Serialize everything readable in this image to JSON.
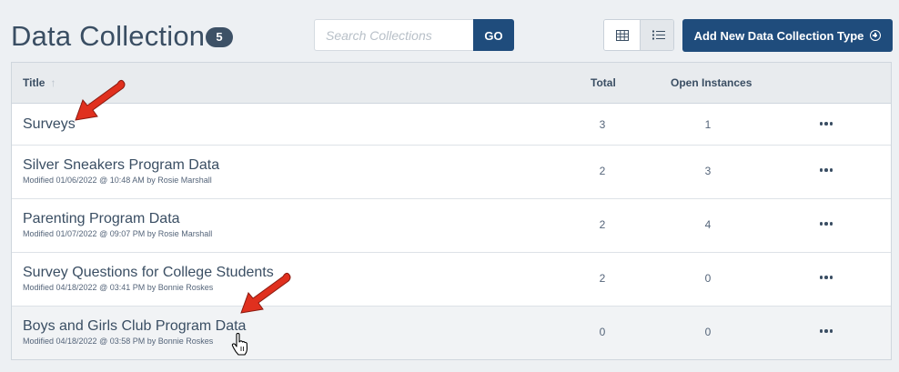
{
  "header": {
    "title": "Data Collection",
    "count": "5"
  },
  "search": {
    "placeholder": "Search Collections",
    "value": "",
    "go_label": "GO"
  },
  "view_toggle": {
    "options": [
      "grid-icon",
      "list-icon"
    ],
    "selected": "list"
  },
  "add_button": {
    "label": "Add New Data Collection Type",
    "icon": "plus-circle-icon"
  },
  "table": {
    "columns": {
      "title": "Title",
      "total": "Total",
      "open": "Open Instances"
    },
    "sort_indicator": "↑",
    "rows": [
      {
        "title": "Surveys",
        "subtitle": "",
        "total": "3",
        "open": "1"
      },
      {
        "title": "Silver Sneakers Program Data",
        "subtitle": "Modified 01/06/2022 @ 10:48 AM by Rosie Marshall",
        "total": "2",
        "open": "3"
      },
      {
        "title": "Parenting Program Data",
        "subtitle": "Modified 01/07/2022 @ 09:07 PM by Rosie Marshall",
        "total": "2",
        "open": "4"
      },
      {
        "title": "Survey Questions for College Students",
        "subtitle": "Modified 04/18/2022 @ 03:41 PM by Bonnie Roskes",
        "total": "2",
        "open": "0"
      },
      {
        "title": "Boys and Girls Club Program Data",
        "subtitle": "Modified 04/18/2022 @ 03:58 PM by Bonnie Roskes",
        "total": "0",
        "open": "0"
      }
    ]
  },
  "colors": {
    "primary": "#1f4c7c",
    "badge": "#3d5166",
    "text": "#3a4e63",
    "annotation_arrow": "#e0301e"
  }
}
